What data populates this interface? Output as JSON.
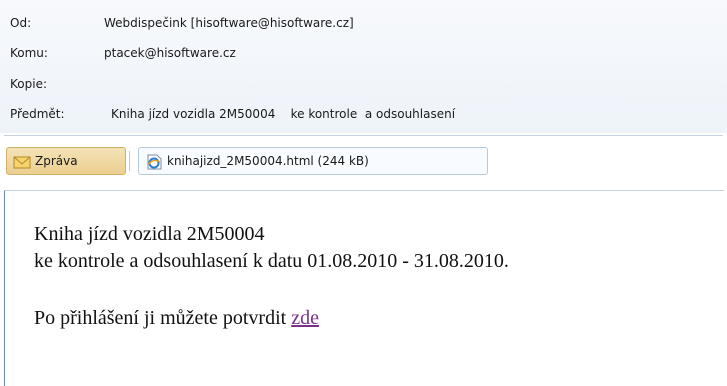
{
  "header": {
    "from": {
      "label": "Od:",
      "value": "Webdispečink [hisoftware@hisoftware.cz]"
    },
    "to": {
      "label": "Komu:",
      "value": "ptacek@hisoftware.cz"
    },
    "cc": {
      "label": "Kopie:",
      "value": ""
    },
    "subject": {
      "label": "Předmět:",
      "value": "Kniha jízd vozidla 2M50004    ke kontrole  a odsouhlasení"
    }
  },
  "toolbar": {
    "message_label": "Zpráva",
    "attachment_label": "knihajizd_2M50004.html (244 kB)"
  },
  "body": {
    "line1": "Kniha jízd vozidla 2M50004",
    "line2": "ke kontrole a odsouhlasení k datu 01.08.2010 - 31.08.2010.",
    "line3_text": "Po přihlášení ji můžete potvrdit ",
    "link": "zde"
  },
  "colors": {
    "header_bg": "#eef3f9",
    "message_tab": "#eccf8f",
    "link": "#7b2f8b"
  },
  "icons": {
    "message": "envelope-icon",
    "attachment": "ie-html-file-icon"
  }
}
